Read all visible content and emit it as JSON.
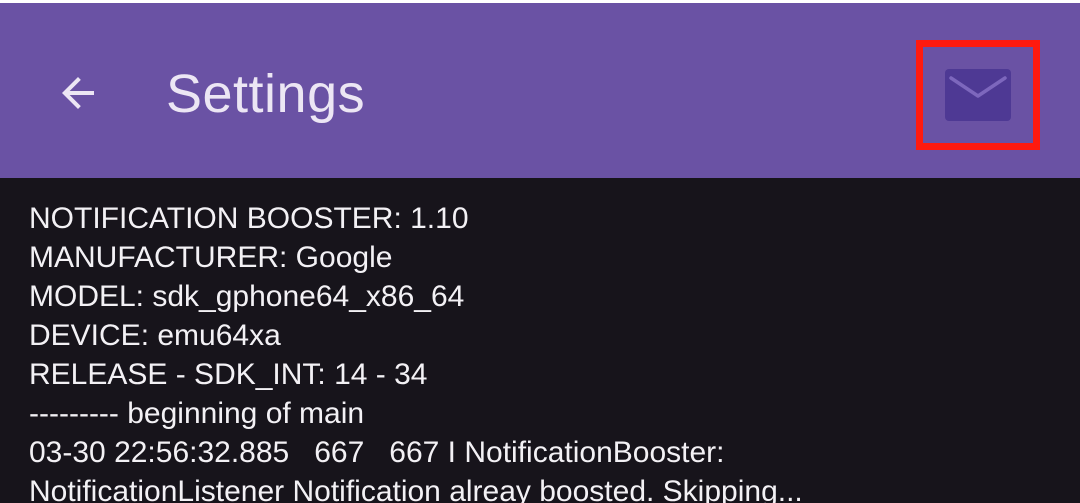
{
  "status_strip_color": "#ffffff",
  "app_bar": {
    "title": "Settings",
    "background_color": "#6a52a4",
    "back_icon": "arrow-left-icon",
    "action_icon": "mail-icon",
    "highlight_color": "#ff1a0f"
  },
  "log": {
    "lines": [
      "NOTIFICATION BOOSTER: 1.10",
      "MANUFACTURER: Google",
      "MODEL: sdk_gphone64_x86_64",
      "DEVICE: emu64xa",
      "RELEASE - SDK_INT: 14 - 34",
      "--------- beginning of main",
      "03-30 22:56:32.885   667   667 I NotificationBooster:",
      "NotificationListener Notification alreay boosted. Skipping..."
    ]
  }
}
